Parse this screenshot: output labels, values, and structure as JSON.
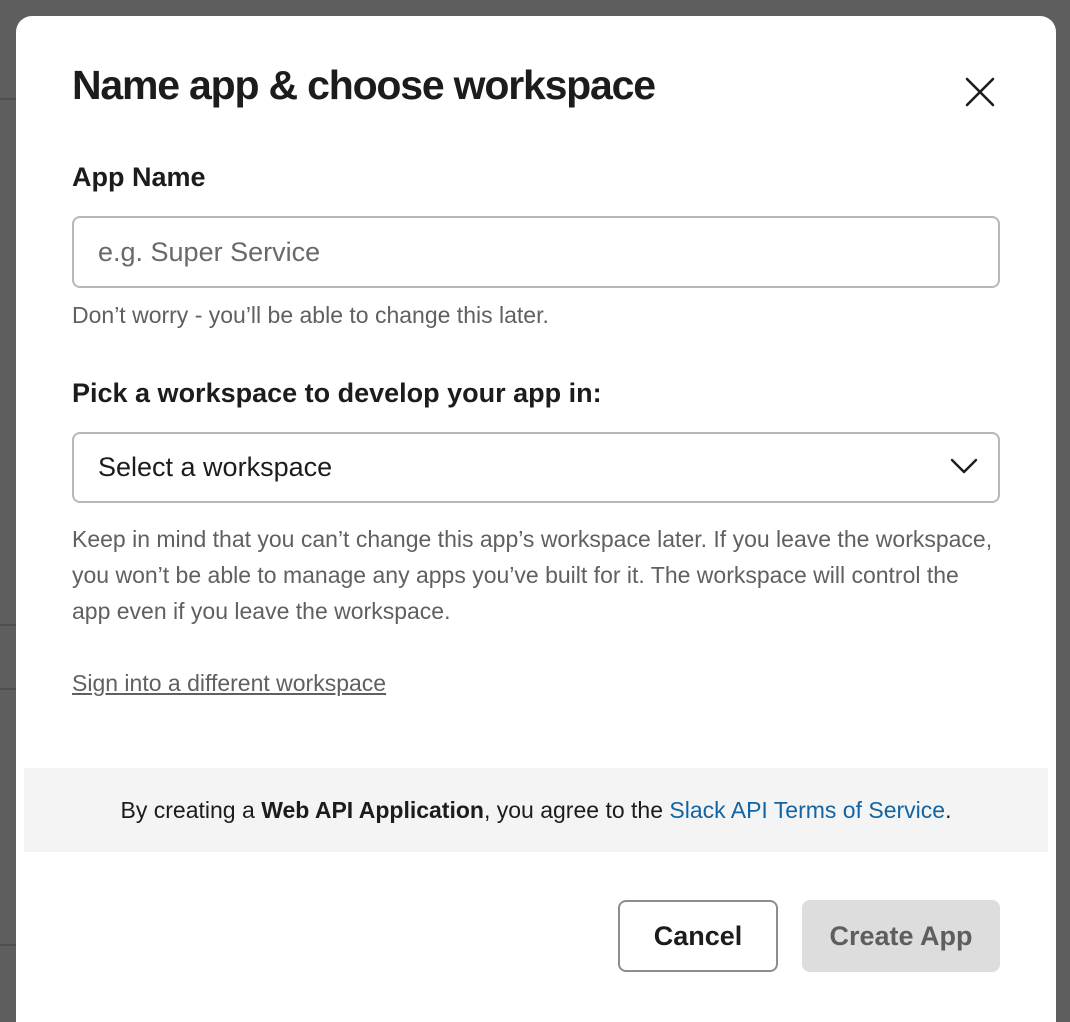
{
  "dialog": {
    "title": "Name app & choose workspace",
    "close_icon": "close-icon",
    "app_name": {
      "label": "App Name",
      "placeholder": "e.g. Super Service",
      "value": "",
      "hint": "Don’t worry - you’ll be able to change this later."
    },
    "workspace": {
      "label": "Pick a workspace to develop your app in:",
      "selected": "Select a workspace",
      "dropdown_icon": "chevron-down-icon",
      "note": "Keep in mind that you can’t change this app’s workspace later. If you leave the workspace, you won’t be able to manage any apps you’ve built for it. The workspace will control the app even if you leave the workspace."
    },
    "signin_link": "Sign into a different workspace",
    "terms": {
      "prefix": "By creating a ",
      "app_type": "Web API Application",
      "middle": ", you agree to the ",
      "link": "Slack API Terms of Service",
      "suffix": "."
    },
    "buttons": {
      "cancel": "Cancel",
      "create": "Create App"
    }
  },
  "colors": {
    "link": "#1264a3",
    "text": "#1d1c1d",
    "muted": "#616061",
    "disabled_button": "#dddddd",
    "overlay": "#5e5e5e"
  }
}
